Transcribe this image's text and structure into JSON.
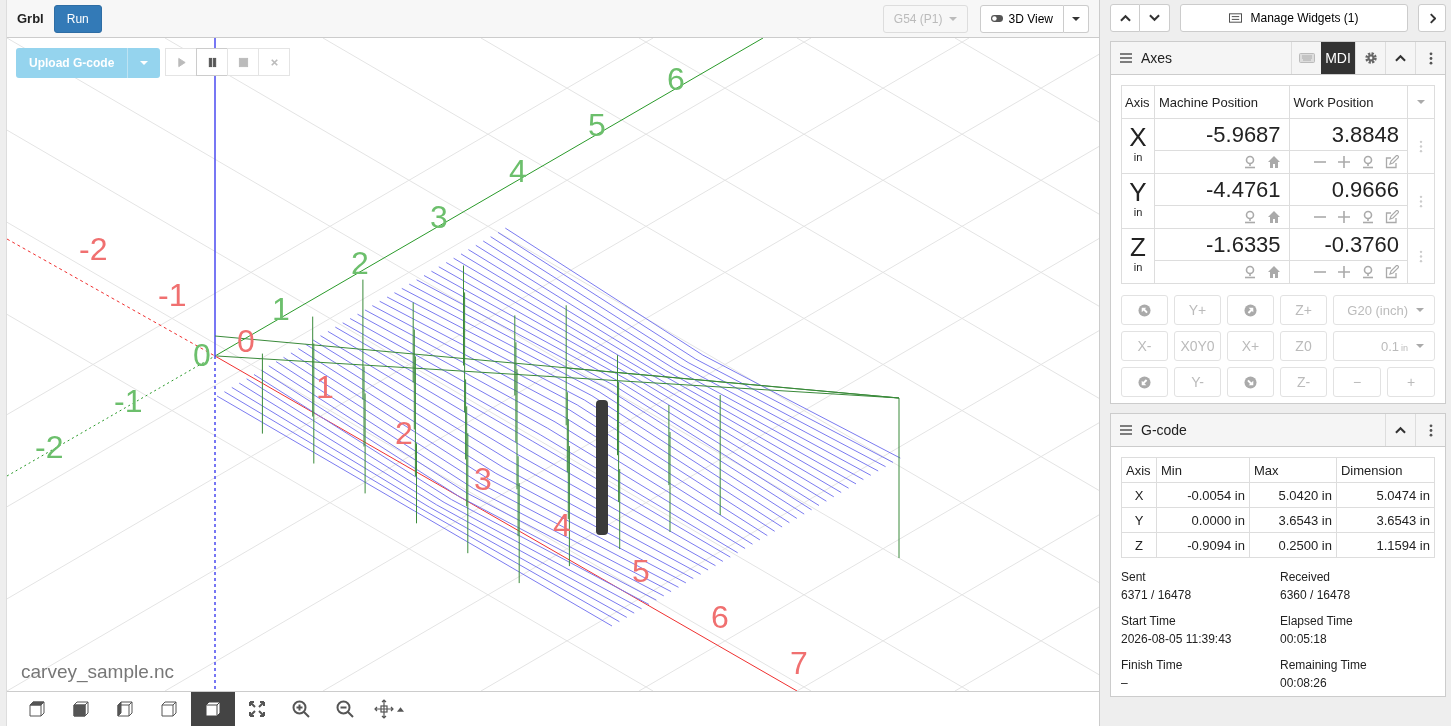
{
  "toolbar": {
    "title": "Grbl",
    "run": "Run",
    "wcs": "G54 (P1)",
    "view": "3D View"
  },
  "viewport": {
    "upload": "Upload G-code",
    "controls": [
      {
        "kind": "play",
        "disabled": true
      },
      {
        "kind": "pause",
        "disabled": false
      },
      {
        "kind": "stop",
        "disabled": true
      },
      {
        "kind": "close",
        "disabled": true
      }
    ],
    "x_labels": [
      "-2",
      "-1",
      "0",
      "1",
      "2",
      "3",
      "4",
      "5",
      "6",
      "7"
    ],
    "y_labels": [
      "-2",
      "-1",
      "0",
      "1",
      "2",
      "3",
      "4",
      "5",
      "6"
    ],
    "file_name": "carvey_sample.nc"
  },
  "view_tools": [
    {
      "kind": "top",
      "selected": false
    },
    {
      "kind": "front",
      "selected": false
    },
    {
      "kind": "left",
      "selected": false
    },
    {
      "kind": "right",
      "selected": false
    },
    {
      "kind": "iso",
      "selected": true
    },
    {
      "kind": "fit",
      "selected": false
    },
    {
      "kind": "zoom-in",
      "selected": false
    },
    {
      "kind": "zoom-out",
      "selected": false
    },
    {
      "kind": "pan",
      "selected": false
    }
  ],
  "widget_bar": {
    "manage": "Manage Widgets (1)"
  },
  "axes": {
    "title": "Axes",
    "mdi": "MDI",
    "mdi_selected": true,
    "columns": [
      "Axis",
      "Machine Position",
      "Work Position"
    ],
    "rows": [
      {
        "axis": "X",
        "unit": "in",
        "machine": "-5.9687",
        "work": "3.8848"
      },
      {
        "axis": "Y",
        "unit": "in",
        "machine": "-4.4761",
        "work": "0.9666"
      },
      {
        "axis": "Z",
        "unit": "in",
        "machine": "-1.6335",
        "work": "-0.3760"
      }
    ],
    "jog": [
      {
        "kind": "northwest"
      },
      {
        "kind": "text",
        "label": "Y+"
      },
      {
        "kind": "northeast"
      },
      {
        "kind": "text",
        "label": "Z+"
      },
      {
        "kind": "select",
        "label": "G20 (inch)"
      },
      {
        "kind": "text",
        "label": "X-"
      },
      {
        "kind": "text",
        "label": "X0Y0"
      },
      {
        "kind": "text",
        "label": "X+"
      },
      {
        "kind": "text",
        "label": "Z0"
      },
      {
        "kind": "select",
        "label": "0.1",
        "unit": "in"
      },
      {
        "kind": "southwest"
      },
      {
        "kind": "text",
        "label": "Y-"
      },
      {
        "kind": "southeast"
      },
      {
        "kind": "text",
        "label": "Z-"
      },
      {
        "kind": "text",
        "label": "−"
      },
      {
        "kind": "text",
        "label": "+"
      }
    ]
  },
  "gcode": {
    "title": "G-code",
    "columns": [
      "Axis",
      "Min",
      "Max",
      "Dimension"
    ],
    "rows": [
      [
        "X",
        "-0.0054 in",
        "5.0420 in",
        "5.0474 in"
      ],
      [
        "Y",
        "0.0000 in",
        "3.6543 in",
        "3.6543 in"
      ],
      [
        "Z",
        "-0.9094 in",
        "0.2500 in",
        "1.1594 in"
      ]
    ],
    "stats": [
      {
        "label": "Sent",
        "value": "6371 / 16478"
      },
      {
        "label": "Received",
        "value": "6360 / 16478"
      },
      {
        "label": "Start Time",
        "value": "2026-08-05 11:39:43"
      },
      {
        "label": "Elapsed Time",
        "value": "00:05:18"
      },
      {
        "label": "Finish Time",
        "value": "–"
      },
      {
        "label": "Remaining Time",
        "value": "00:08:26"
      }
    ]
  }
}
